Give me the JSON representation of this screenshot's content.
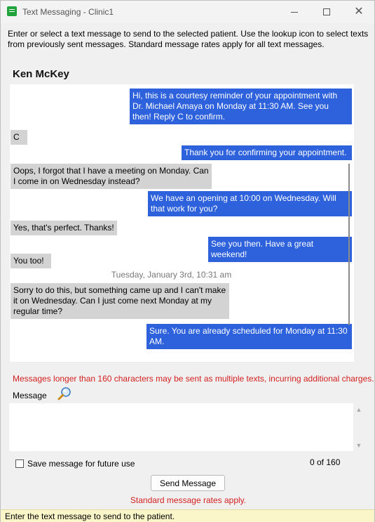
{
  "window": {
    "title": "Text Messaging - Clinic1",
    "icon": "message-icon",
    "controls": [
      "minimize-icon",
      "maximize-icon",
      "close-icon"
    ],
    "close_glyph": "✕"
  },
  "instructions": "Enter or select a text message to send to the selected patient. Use the lookup icon to select texts from previously sent messages. Standard message rates apply for all text messages.",
  "patient_name": "Ken McKey",
  "conversation": {
    "messages": [
      {
        "direction": "out",
        "text": "Hi, this is a courtesy reminder of your appointment with Dr. Michael Amaya on Monday at 11:30 AM. See you then! Reply C to confirm."
      },
      {
        "direction": "in",
        "text": "C"
      },
      {
        "direction": "out",
        "text": "Thank you for confirming your appointment."
      },
      {
        "direction": "in",
        "text": "Oops, I forgot that I have a meeting on Monday. Can I come in on Wednesday instead?"
      },
      {
        "direction": "out",
        "text": "We have an opening at 10:00 on Wednesday. Will that work for you?"
      },
      {
        "direction": "in",
        "text": "Yes, that's perfect. Thanks!"
      },
      {
        "direction": "out",
        "text": "See you then. Have a great weekend!"
      },
      {
        "direction": "in",
        "text": "You too!"
      },
      {
        "direction": "in",
        "text": "Sorry to do this, but something came up and I can't make it on Wednesday. Can I just come next Monday at my regular time?"
      },
      {
        "direction": "out",
        "text": "Sure. You are already scheduled for Monday at 11:30 AM."
      }
    ],
    "date_divider": "Tuesday, January 3rd, 10:31 am",
    "colors": {
      "outgoing": "#2d62dc",
      "incoming": "#d3d3d3"
    }
  },
  "warning": "Messages longer than 160 characters may be sent as multiple texts, incurring additional charges.",
  "message_field": {
    "label": "Message",
    "lookup_icon": "magnifier-icon",
    "value": "",
    "scroll_up": "▲",
    "scroll_down": "▼"
  },
  "save_option": {
    "label": "Save message for future use",
    "checked": false
  },
  "counter": "0 of 160",
  "send_button": "Send Message",
  "rates_note": "Standard message rates apply.",
  "status_bar": "Enter the text message to send to the patient.",
  "colors": {
    "warning": "#d42020",
    "status_bar_bg": "#fbf6c9"
  }
}
